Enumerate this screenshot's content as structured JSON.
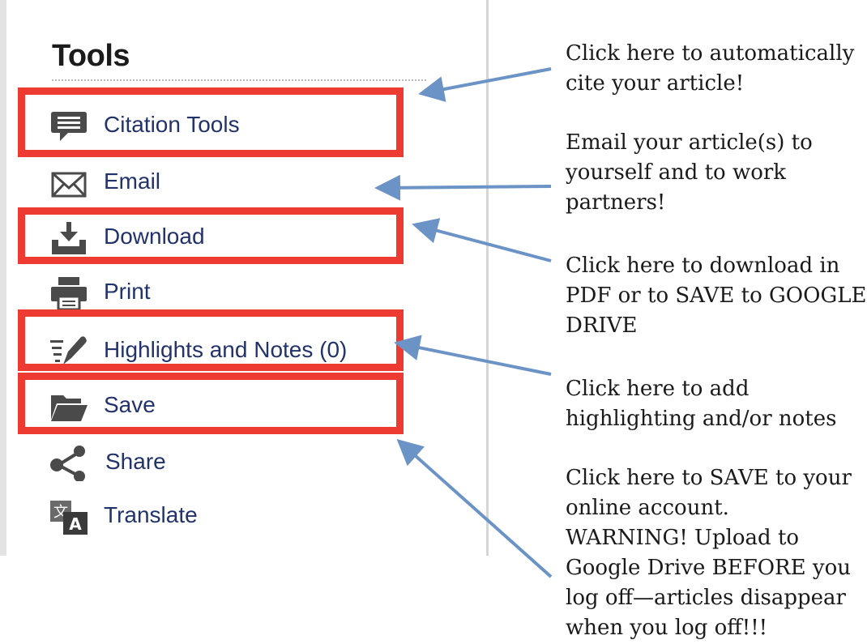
{
  "tools_panel": {
    "title": "Tools",
    "items": [
      {
        "label": "Citation Tools",
        "icon": "speech-bubble-icon",
        "highlighted": true
      },
      {
        "label": "Email",
        "icon": "envelope-icon",
        "highlighted": false
      },
      {
        "label": "Download",
        "icon": "download-tray-icon",
        "highlighted": true
      },
      {
        "label": "Print",
        "icon": "printer-icon",
        "highlighted": false
      },
      {
        "label": "Highlights and Notes (0)",
        "icon": "highlight-pen-icon",
        "highlighted": true
      },
      {
        "label": "Save",
        "icon": "folder-icon",
        "highlighted": true
      },
      {
        "label": "Share",
        "icon": "share-icon",
        "highlighted": false
      },
      {
        "label": "Translate",
        "icon": "translate-icon",
        "highlighted": false
      }
    ]
  },
  "callouts": {
    "cite": "Click here to automatically\ncite your article!",
    "email": "Email your article(s) to\nyourself and to work\npartners!",
    "download": "Click here to download in\nPDF or to SAVE to GOOGLE\nDRIVE",
    "highlight": "Click here to add\nhighlighting and/or notes",
    "save": "Click here to SAVE to your\nonline account.\nWARNING!  Upload to\nGoogle Drive BEFORE you\nlog off—articles disappear\nwhen you log off!!!"
  },
  "colors": {
    "highlight_box": "#ee3b31",
    "arrow": "#6b93c6",
    "link_text": "#22336b"
  }
}
